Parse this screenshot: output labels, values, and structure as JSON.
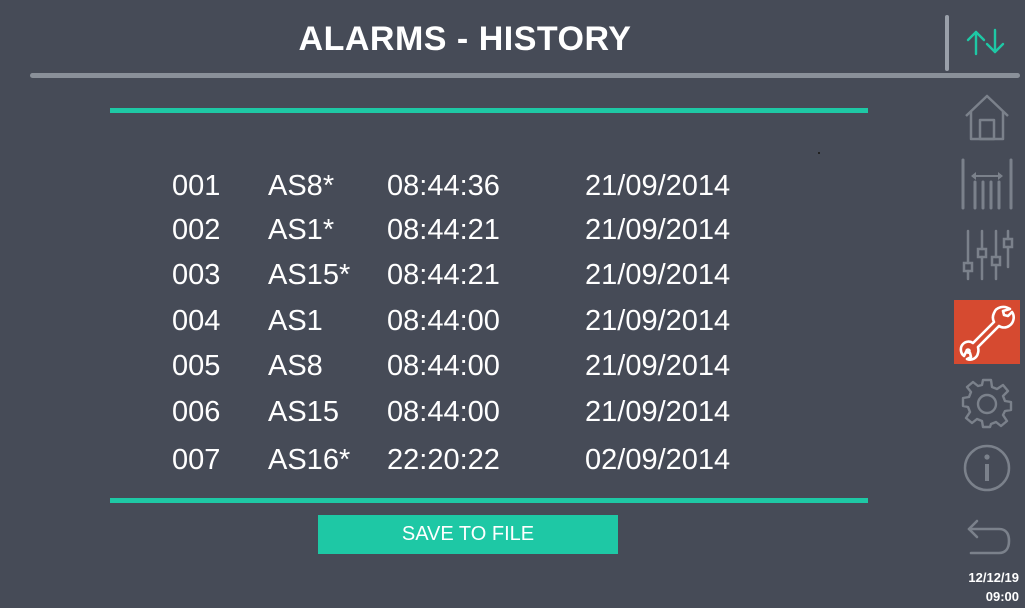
{
  "header": {
    "title": "ALARMS - HISTORY"
  },
  "alarms": [
    {
      "num": "001",
      "code": "AS8*",
      "time": "08:44:36",
      "date": "21/09/2014"
    },
    {
      "num": "002",
      "code": "AS1*",
      "time": "08:44:21",
      "date": "21/09/2014"
    },
    {
      "num": "003",
      "code": "AS15*",
      "time": "08:44:21",
      "date": "21/09/2014"
    },
    {
      "num": "004",
      "code": "AS1",
      "time": "08:44:00",
      "date": "21/09/2014"
    },
    {
      "num": "005",
      "code": "AS8",
      "time": "08:44:00",
      "date": "21/09/2014"
    },
    {
      "num": "006",
      "code": "AS15",
      "time": "08:44:00",
      "date": "21/09/2014"
    },
    {
      "num": "007",
      "code": "AS16*",
      "time": "22:20:22",
      "date": "02/09/2014"
    }
  ],
  "actions": {
    "save_label": "SAVE TO FILE"
  },
  "sidebar": {
    "items": [
      {
        "icon": "scroll-arrows-icon"
      },
      {
        "icon": "home-icon"
      },
      {
        "icon": "gauge-levels-icon"
      },
      {
        "icon": "sliders-icon"
      },
      {
        "icon": "wrench-icon",
        "active": true
      },
      {
        "icon": "gear-icon"
      },
      {
        "icon": "info-icon"
      },
      {
        "icon": "back-arrow-icon"
      }
    ]
  },
  "status": {
    "date": "12/12/19",
    "time": "09:00"
  },
  "colors": {
    "background": "#464b57",
    "accent": "#1ec8a5",
    "active": "#d64a30",
    "icon_inactive": "#7b818b"
  }
}
